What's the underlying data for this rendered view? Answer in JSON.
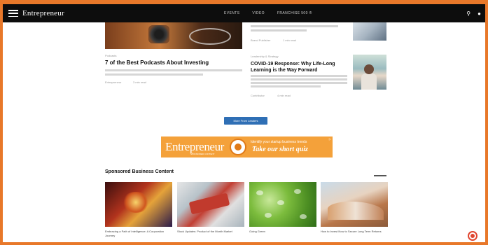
{
  "header": {
    "logo_text": "Entrepreneur",
    "nav": [
      "EVENTS",
      "VIDEO",
      "FRANCHISE 500 ®"
    ]
  },
  "top_story_right": {
    "meta_author": "Brand Publisher",
    "meta_time": "1 min read"
  },
  "articles": {
    "left": {
      "label": "Podcasts",
      "title": "7 of the Best Podcasts About Investing",
      "meta_author": "Entrepreneur",
      "meta_time": "3 min read"
    },
    "right": {
      "label": "Leadership & Strategy",
      "title": "COVID-19 Response: Why Life-Long Learning is the Way Forward",
      "meta_author": "Contributor",
      "meta_time": "4 min read"
    }
  },
  "more_button": "More From Leaders",
  "ad": {
    "logo": "Entrepreneur",
    "sub": "SPONSORED CONTENT",
    "top_line": "Identify your startup business trends",
    "main_line": "Take our short quiz"
  },
  "sponsored": {
    "heading": "Sponsored Business Content",
    "cards": [
      {
        "caption": "Embracing a Path of Intelligence: A Corporation Journey"
      },
      {
        "caption": "Stock Updates: Product of the Month Market"
      },
      {
        "caption": "Going Green"
      },
      {
        "caption": "How to Invest Now to Secure Long Term Returns"
      }
    ]
  },
  "colors": {
    "frame": "#e8782a",
    "topbar": "#0d0d0d",
    "button": "#2f6fb5",
    "ad": "#f4a13a"
  }
}
